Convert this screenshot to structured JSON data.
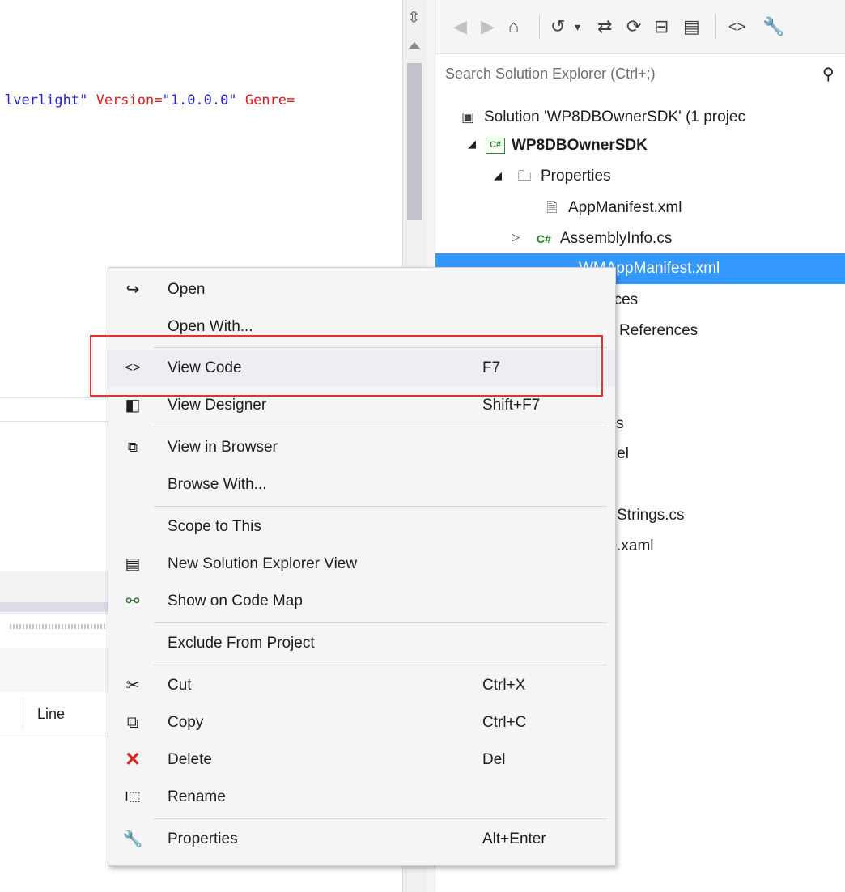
{
  "editor": {
    "code_parts": [
      "lverlight\"",
      " Version=",
      "\"1.0.0.0\"",
      " Genre="
    ],
    "error_list_column": "Line"
  },
  "toolbar": {
    "icons": [
      "back-icon",
      "forward-icon",
      "home-icon",
      "history-icon",
      "sync-icon",
      "refresh-icon",
      "collapse-all-icon",
      "show-all-files-icon",
      "view-code-icon",
      "properties-icon"
    ]
  },
  "search": {
    "placeholder": "Search Solution Explorer (Ctrl+;)"
  },
  "tree": {
    "solution": "Solution 'WP8DBOwnerSDK' (1 projec",
    "project": "WP8DBOwnerSDK",
    "properties_folder": "Properties",
    "app_manifest": "AppManifest.xml",
    "assembly_info": "AssemblyInfo.cs",
    "wm_app_manifest": "WMAppManifest.xml",
    "partial_1": "nces",
    "partial_2": "References",
    "partial_3": "ces",
    "partial_4": "odel",
    "partial_5": "ml",
    "partial_6": "edStrings.cs",
    "partial_7": "ge.xaml"
  },
  "menu": {
    "items": [
      {
        "label": "Open",
        "shortcut": ""
      },
      {
        "label": "Open With...",
        "shortcut": ""
      },
      {
        "label": "View Code",
        "shortcut": "F7"
      },
      {
        "label": "View Designer",
        "shortcut": "Shift+F7"
      },
      {
        "label": "View in Browser",
        "shortcut": ""
      },
      {
        "label": "Browse With...",
        "shortcut": ""
      },
      {
        "label": "Scope to This",
        "shortcut": ""
      },
      {
        "label": "New Solution Explorer View",
        "shortcut": ""
      },
      {
        "label": "Show on Code Map",
        "shortcut": ""
      },
      {
        "label": "Exclude From Project",
        "shortcut": ""
      },
      {
        "label": "Cut",
        "shortcut": "Ctrl+X"
      },
      {
        "label": "Copy",
        "shortcut": "Ctrl+C"
      },
      {
        "label": "Delete",
        "shortcut": "Del"
      },
      {
        "label": "Rename",
        "shortcut": ""
      },
      {
        "label": "Properties",
        "shortcut": "Alt+Enter"
      }
    ]
  },
  "colors": {
    "selection": "#3399ff",
    "highlight_box": "#e8302f",
    "delete_icon": "#d9231f",
    "csharp_green": "#2a8a2a"
  }
}
